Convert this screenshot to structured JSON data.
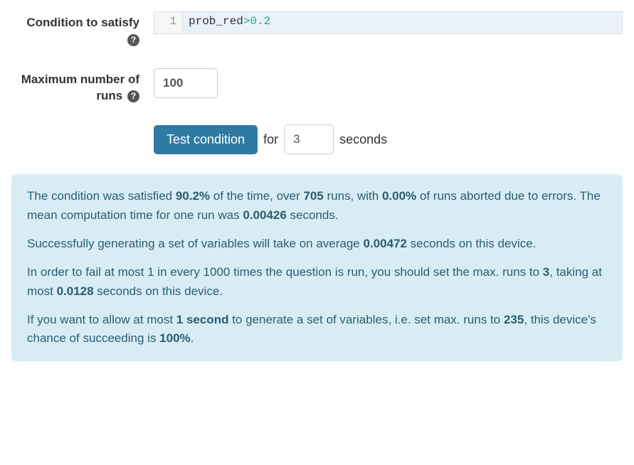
{
  "form": {
    "condition": {
      "label": "Condition to satisfy",
      "code_line_number": "1",
      "code_var": "prob_red",
      "code_op": ">",
      "code_num": "0.2"
    },
    "max_runs": {
      "label": "Maximum number of runs",
      "value": "100"
    },
    "test": {
      "button": "Test condition",
      "for_text": "for",
      "seconds_value": "3",
      "seconds_text": "seconds"
    }
  },
  "result": {
    "p1_a": "The condition was satisfied ",
    "p1_pct": "90.2%",
    "p1_b": " of the time, over ",
    "p1_runs": "705",
    "p1_c": " runs, with ",
    "p1_abort": "0.00%",
    "p1_d": " of runs aborted due to errors. The mean computation time for one run was ",
    "p1_time": "0.00426",
    "p1_e": " seconds.",
    "p2_a": "Successfully generating a set of variables will take on average ",
    "p2_time": "0.00472",
    "p2_b": " seconds on this device.",
    "p3_a": "In order to fail at most 1 in every 1000 times the question is run, you should set the max. runs to ",
    "p3_runs": "3",
    "p3_b": ", taking at most ",
    "p3_time": "0.0128",
    "p3_c": " seconds on this device.",
    "p4_a": "If you want to allow at most ",
    "p4_time": "1 second",
    "p4_b": " to generate a set of variables, i.e. set max. runs to ",
    "p4_runs": "235",
    "p4_c": ", this device's chance of succeeding is ",
    "p4_pct": "100%",
    "p4_d": "."
  }
}
